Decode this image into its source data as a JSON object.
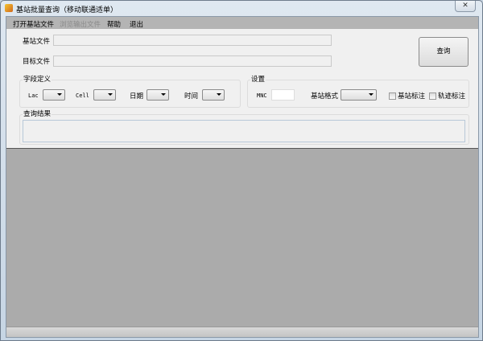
{
  "window": {
    "title": "基站批量查询（移动联通适单）",
    "close": "✕"
  },
  "menu": [
    "打开基站文件",
    "浏览输出文件",
    "帮助",
    "退出"
  ],
  "fields": {
    "base_file_label": "基站文件",
    "target_file_label": "目标文件",
    "base_file_value": "",
    "target_file_value": ""
  },
  "query_button": "查询",
  "field_def": {
    "title": "字段定义",
    "lac": "Lac",
    "cell": "Cell",
    "date": "日期",
    "time": "时间"
  },
  "settings": {
    "title": "设置",
    "mnc": "MNC",
    "mnc_value": "",
    "format_label": "基站格式",
    "base_mark": "基站标注",
    "track_mark": "轨迹标注"
  },
  "result": {
    "title": "查询结果"
  }
}
